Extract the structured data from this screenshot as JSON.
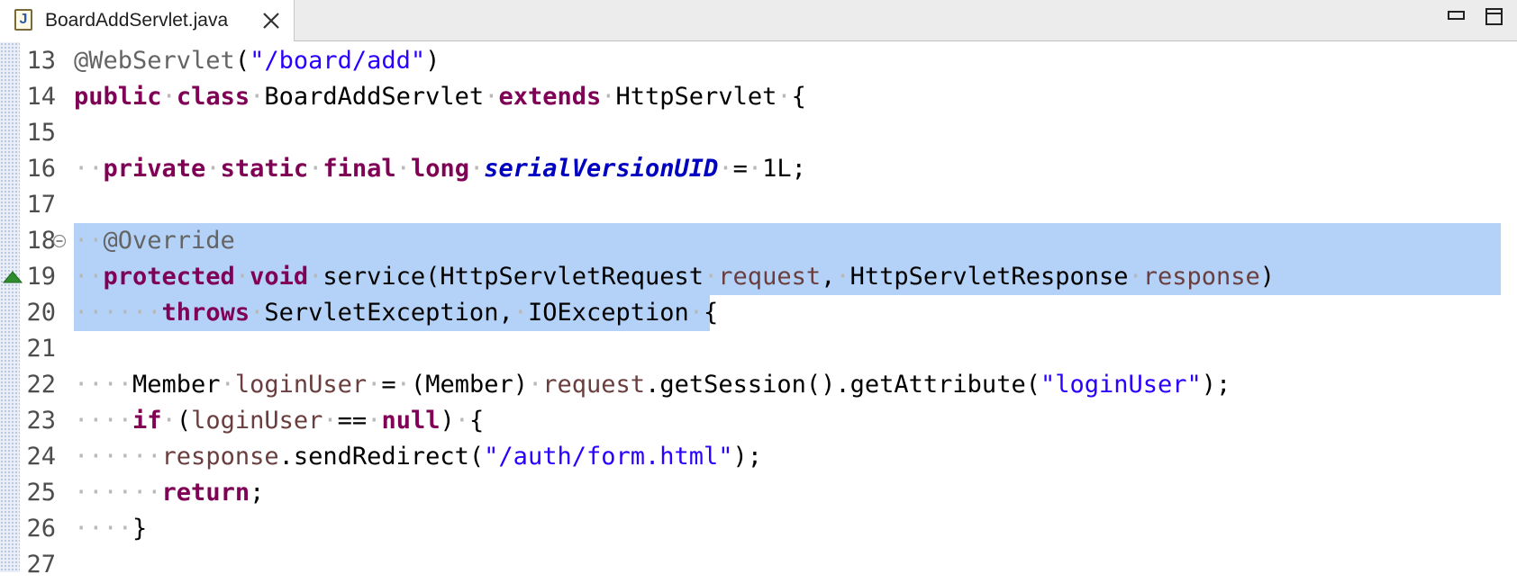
{
  "tab": {
    "title": "BoardAddServlet.java",
    "icon": "java-file-icon",
    "icon_letter": "J"
  },
  "window_controls": [
    "minimize-icon",
    "maximize-icon"
  ],
  "colors": {
    "keyword": "#7f0055",
    "string": "#2a00ff",
    "field": "#0000c0",
    "local_variable": "#6a3e3e",
    "annotation": "#646464",
    "selection": "#b4d2f8",
    "override_marker": "#2e8b2e"
  },
  "editor": {
    "selected_lines": [
      18,
      19,
      20
    ],
    "lines": [
      {
        "num": "13",
        "tokens": [
          {
            "t": "@WebServlet",
            "c": "ann"
          },
          {
            "t": "(",
            "c": ""
          },
          {
            "t": "\"/board/add\"",
            "c": "str"
          },
          {
            "t": ")",
            "c": ""
          }
        ]
      },
      {
        "num": "14",
        "tokens": [
          {
            "t": "public",
            "c": "kw"
          },
          {
            "t": "·",
            "c": "ws"
          },
          {
            "t": "class",
            "c": "kw"
          },
          {
            "t": "·",
            "c": "ws"
          },
          {
            "t": "BoardAddServlet",
            "c": ""
          },
          {
            "t": "·",
            "c": "ws"
          },
          {
            "t": "extends",
            "c": "kw"
          },
          {
            "t": "·",
            "c": "ws"
          },
          {
            "t": "HttpServlet",
            "c": ""
          },
          {
            "t": "·",
            "c": "ws"
          },
          {
            "t": "{",
            "c": ""
          }
        ]
      },
      {
        "num": "15",
        "tokens": []
      },
      {
        "num": "16",
        "tokens": [
          {
            "t": "··",
            "c": "ws"
          },
          {
            "t": "private",
            "c": "kw"
          },
          {
            "t": "·",
            "c": "ws"
          },
          {
            "t": "static",
            "c": "kw"
          },
          {
            "t": "·",
            "c": "ws"
          },
          {
            "t": "final",
            "c": "kw"
          },
          {
            "t": "·",
            "c": "ws"
          },
          {
            "t": "long",
            "c": "kw"
          },
          {
            "t": "·",
            "c": "ws"
          },
          {
            "t": "serialVersionUID",
            "c": "fld"
          },
          {
            "t": "·",
            "c": "ws"
          },
          {
            "t": "=",
            "c": ""
          },
          {
            "t": "·",
            "c": "ws"
          },
          {
            "t": "1L;",
            "c": ""
          }
        ]
      },
      {
        "num": "17",
        "tokens": []
      },
      {
        "num": "18",
        "fold": true,
        "tokens": [
          {
            "t": "··",
            "c": "ws"
          },
          {
            "t": "@Override",
            "c": "ann"
          }
        ]
      },
      {
        "num": "19",
        "override": true,
        "tokens": [
          {
            "t": "··",
            "c": "ws"
          },
          {
            "t": "protected",
            "c": "kw"
          },
          {
            "t": "·",
            "c": "ws"
          },
          {
            "t": "void",
            "c": "kw"
          },
          {
            "t": "·",
            "c": "ws"
          },
          {
            "t": "service(HttpServletRequest",
            "c": ""
          },
          {
            "t": "·",
            "c": "ws"
          },
          {
            "t": "request",
            "c": "var"
          },
          {
            "t": ",",
            "c": ""
          },
          {
            "t": "·",
            "c": "ws"
          },
          {
            "t": "HttpServletResponse",
            "c": ""
          },
          {
            "t": "·",
            "c": "ws"
          },
          {
            "t": "response",
            "c": "var"
          },
          {
            "t": ")",
            "c": ""
          }
        ]
      },
      {
        "num": "20",
        "tokens": [
          {
            "t": "······",
            "c": "ws"
          },
          {
            "t": "throws",
            "c": "kw"
          },
          {
            "t": "·",
            "c": "ws"
          },
          {
            "t": "ServletException,",
            "c": ""
          },
          {
            "t": "·",
            "c": "ws"
          },
          {
            "t": "IOException",
            "c": ""
          },
          {
            "t": "·",
            "c": "ws"
          },
          {
            "t": "{",
            "c": ""
          }
        ]
      },
      {
        "num": "21",
        "tokens": []
      },
      {
        "num": "22",
        "tokens": [
          {
            "t": "····",
            "c": "ws"
          },
          {
            "t": "Member",
            "c": ""
          },
          {
            "t": "·",
            "c": "ws"
          },
          {
            "t": "loginUser",
            "c": "var"
          },
          {
            "t": "·",
            "c": "ws"
          },
          {
            "t": "=",
            "c": ""
          },
          {
            "t": "·",
            "c": "ws"
          },
          {
            "t": "(Member)",
            "c": ""
          },
          {
            "t": "·",
            "c": "ws"
          },
          {
            "t": "request",
            "c": "var"
          },
          {
            "t": ".getSession().getAttribute(",
            "c": ""
          },
          {
            "t": "\"loginUser\"",
            "c": "str"
          },
          {
            "t": ");",
            "c": ""
          }
        ]
      },
      {
        "num": "23",
        "tokens": [
          {
            "t": "····",
            "c": "ws"
          },
          {
            "t": "if",
            "c": "kw"
          },
          {
            "t": "·",
            "c": "ws"
          },
          {
            "t": "(",
            "c": ""
          },
          {
            "t": "loginUser",
            "c": "var"
          },
          {
            "t": "·",
            "c": "ws"
          },
          {
            "t": "==",
            "c": ""
          },
          {
            "t": "·",
            "c": "ws"
          },
          {
            "t": "null",
            "c": "kw"
          },
          {
            "t": ")",
            "c": ""
          },
          {
            "t": "·",
            "c": "ws"
          },
          {
            "t": "{",
            "c": ""
          }
        ]
      },
      {
        "num": "24",
        "tokens": [
          {
            "t": "······",
            "c": "ws"
          },
          {
            "t": "response",
            "c": "var"
          },
          {
            "t": ".sendRedirect(",
            "c": ""
          },
          {
            "t": "\"/auth/form.html\"",
            "c": "str"
          },
          {
            "t": ");",
            "c": ""
          }
        ]
      },
      {
        "num": "25",
        "tokens": [
          {
            "t": "······",
            "c": "ws"
          },
          {
            "t": "return",
            "c": "kw"
          },
          {
            "t": ";",
            "c": ""
          }
        ]
      },
      {
        "num": "26",
        "tokens": [
          {
            "t": "····",
            "c": "ws"
          },
          {
            "t": "}",
            "c": ""
          }
        ]
      },
      {
        "num": "27",
        "tokens": []
      }
    ]
  }
}
